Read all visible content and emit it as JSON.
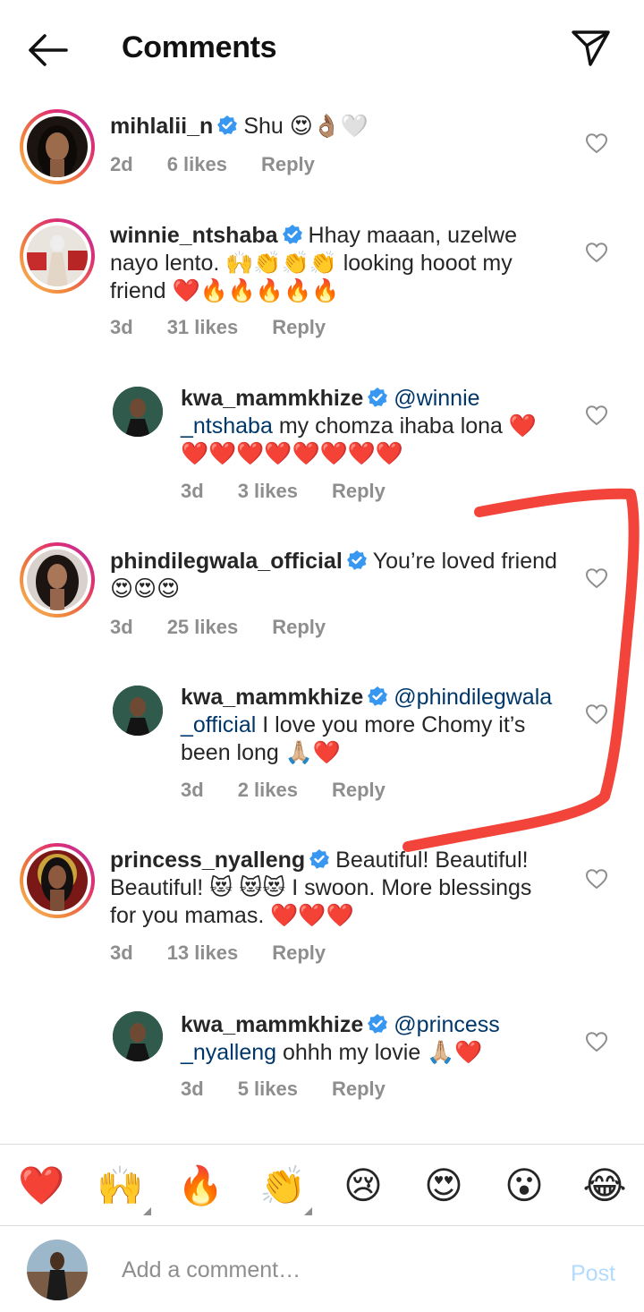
{
  "header": {
    "title": "Comments",
    "back_icon": "arrow-left-icon",
    "share_icon": "paper-plane-icon"
  },
  "comments": [
    {
      "username": "mihlalii_n",
      "verified": true,
      "text": "Shu 😍👌🏽🤍",
      "time": "2d",
      "likes": "6 likes",
      "reply": "Reply"
    },
    {
      "username": "winnie_ntshaba",
      "verified": true,
      "text_line1": "Hhay maaan, uzelwe",
      "text_line2": "nayo lento. 🙌👏👏👏 looking hooot my",
      "text_line3": "friend ❤️🔥🔥🔥🔥🔥",
      "time": "3d",
      "likes": "31 likes",
      "reply": "Reply"
    },
    {
      "username": "kwa_mammkhize",
      "verified": true,
      "mention": "@winnie",
      "mention2": "_ntshaba",
      "text_line2": " my chomza ihaba lona ❤️",
      "text_line3": "❤️❤️❤️❤️❤️❤️❤️❤️",
      "time": "3d",
      "likes": "3 likes",
      "reply": "Reply"
    },
    {
      "username": "phindilegwala_official",
      "verified": true,
      "text": "You’re loved friend",
      "text_line2": "😍😍😍",
      "time": "3d",
      "likes": "25 likes",
      "reply": "Reply"
    },
    {
      "username": "kwa_mammkhize",
      "verified": true,
      "mention": "@phindilegwala",
      "mention2": "_official",
      "text_line2": " I love you more Chomy it’s",
      "text_line3": "been long 🙏🏼❤️",
      "time": "3d",
      "likes": "2 likes",
      "reply": "Reply"
    },
    {
      "username": "princess_nyalleng",
      "verified": true,
      "text": "Beautiful! Beautiful!",
      "text_line2": "Beautiful! 😻 😻😻 I swoon. More blessings",
      "text_line3": "for you mamas. ❤️❤️❤️",
      "time": "3d",
      "likes": "13 likes",
      "reply": "Reply"
    },
    {
      "username": "kwa_mammkhize",
      "verified": true,
      "mention": "@princess",
      "mention2": "_nyalleng",
      "text_line2": " ohhh my lovie 🙏🏼❤️",
      "time": "3d",
      "likes": "5 likes",
      "reply": "Reply"
    }
  ],
  "emoji_bar": [
    "❤️",
    "🙌",
    "🔥",
    "👏",
    "😢",
    "😍",
    "😮",
    "😂"
  ],
  "composer": {
    "placeholder": "Add a comment…",
    "post_label": "Post"
  },
  "colors": {
    "mention": "#00376b",
    "meta": "#8e8e8e",
    "post_disabled": "#b3dbff",
    "verified": "#3897f0",
    "annotation": "#f2443a"
  }
}
